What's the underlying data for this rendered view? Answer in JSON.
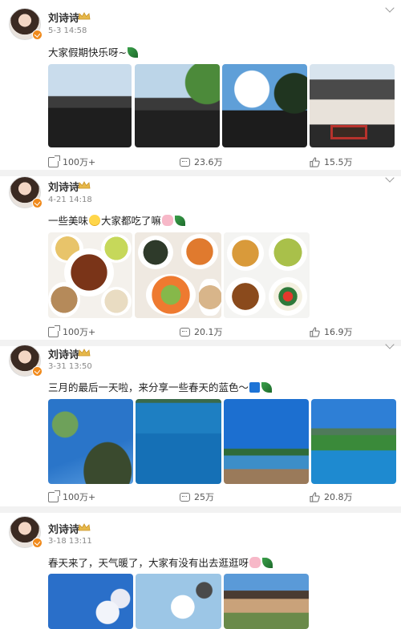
{
  "posts": [
    {
      "author": "刘诗诗",
      "time": "5-3 14:58",
      "text": "大家假期快乐呀~",
      "emojis": [
        "leaf-emoji"
      ],
      "images": [
        "rooftop-sky-photo",
        "tree-rooftop-photo",
        "clouds-rooftop-photo",
        "red-window-wall-photo"
      ],
      "reposts": "100万+",
      "comments": "23.6万",
      "likes": "15.5万"
    },
    {
      "author": "刘诗诗",
      "time": "4-21 14:18",
      "text_before": "一些美味",
      "text_middle": "大家都吃了嘛",
      "emojis": [
        "yum-emoji",
        "pig-emoji",
        "leaf-emoji"
      ],
      "images": [
        "dishes-photo-1",
        "dishes-photo-2",
        "dishes-photo-3"
      ],
      "reposts": "100万+",
      "comments": "20.1万",
      "likes": "16.9万"
    },
    {
      "author": "刘诗诗",
      "time": "3-31 13:50",
      "text": "三月的最后一天啦，来分享一些春天的蓝色～",
      "emojis": [
        "blue-square-emoji",
        "leaf-emoji"
      ],
      "images": [
        "tree-blue-sky-photo",
        "blue-water-photo",
        "lake-shore-photo",
        "mountain-lake-photo"
      ],
      "reposts": "100万+",
      "comments": "25万",
      "likes": "20.8万"
    },
    {
      "author": "刘诗诗",
      "time": "3-18 13:11",
      "text": "春天来了，天气暖了，大家有没有出去逛逛呀",
      "emojis": [
        "pig-emoji",
        "leaf-emoji"
      ],
      "images": [
        "blossom-blue-photo",
        "white-blossom-photo",
        "pavilion-photo"
      ]
    }
  ],
  "colors": {
    "accent": "#f08a1c",
    "muted": "#888888"
  }
}
